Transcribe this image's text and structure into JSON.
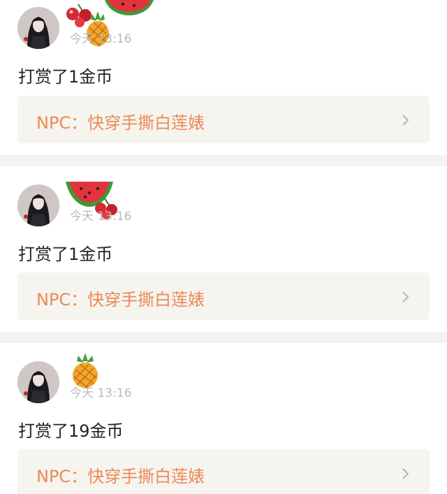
{
  "feed": {
    "items": [
      {
        "time": "今天 13:16",
        "reward_text": "打赏了1金币",
        "book_label": "NPC：快穿手撕白莲婊",
        "gift_icons": [
          "cherry-icon",
          "watermelon-icon",
          "pineapple-icon"
        ]
      },
      {
        "time": "今天 13:16",
        "reward_text": "打赏了1金币",
        "book_label": "NPC：快穿手撕白莲婊",
        "gift_icons": [
          "watermelon-icon",
          "cherry-icon"
        ]
      },
      {
        "time": "今天 13:16",
        "reward_text": "打赏了19金币",
        "book_label": "NPC：快穿手撕白莲婊",
        "gift_icons": [
          "pineapple-icon"
        ]
      }
    ]
  },
  "colors": {
    "link_text": "#eb8a57",
    "link_bg": "#f6f4ef",
    "separator": "#f3f3f5",
    "time_text": "#b9b9b9",
    "body_text": "#222222"
  },
  "icons": {
    "chevron": "chevron-right-icon",
    "avatar": "avatar"
  }
}
